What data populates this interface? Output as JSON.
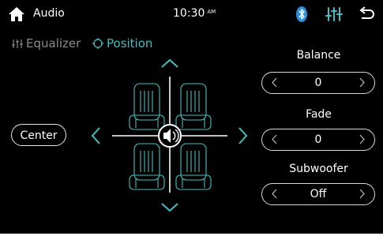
{
  "status_bar": {
    "title": "Audio",
    "time": "10:30",
    "ampm": "AM",
    "icons": [
      "home-icon",
      "bluetooth-icon",
      "equalizer-icon",
      "back-icon"
    ]
  },
  "tabs": [
    {
      "label": "Equalizer",
      "icon": "equalizer-sliders-icon",
      "active": false
    },
    {
      "label": "Position",
      "icon": "position-target-icon",
      "active": true
    }
  ],
  "center_button": {
    "label": "Center"
  },
  "controls": {
    "balance": {
      "label": "Balance",
      "value": "0"
    },
    "fade": {
      "label": "Fade",
      "value": "0"
    },
    "subwoofer": {
      "label": "Subwoofer",
      "value": "Off"
    }
  },
  "colors": {
    "accent": "#3fbfbf",
    "background": "#000000",
    "text": "#ffffff",
    "inactive": "#8b8b8b"
  }
}
